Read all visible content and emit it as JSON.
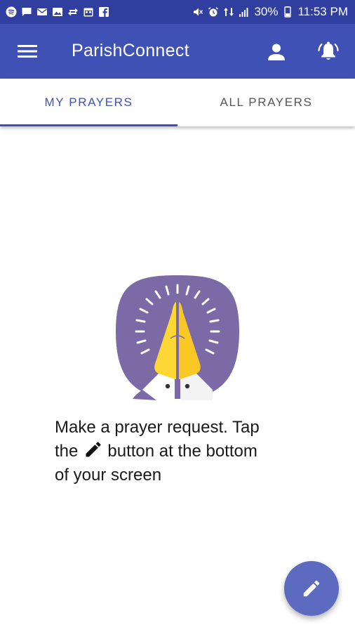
{
  "status_bar": {
    "battery": "30%",
    "time": "11:53 PM",
    "left_icons": [
      "spotify-icon",
      "message-icon",
      "mail-icon",
      "image-icon",
      "transfer-icon",
      "calendar-icon",
      "facebook-icon"
    ],
    "right_icons": [
      "mute-icon",
      "alarm-icon",
      "data-icon",
      "signal-icon",
      "battery-icon"
    ]
  },
  "app_bar": {
    "title": "ParishConnect",
    "menu_icon": "menu-icon",
    "profile_icon": "person-icon",
    "notification_icon": "bell-icon"
  },
  "tabs": [
    {
      "label": "MY PRAYERS",
      "active": true
    },
    {
      "label": "ALL PRAYERS",
      "active": false
    }
  ],
  "empty_state": {
    "illustration": "praying-hands-icon",
    "line1": "Make a prayer request. Tap",
    "line2_before": "the",
    "line2_after": "button at the bottom",
    "line3": "of your screen"
  },
  "fab": {
    "icon": "pencil-icon"
  },
  "colors": {
    "status_bar": "#303f9f",
    "app_bar": "#3f51b5",
    "accent": "#3f51b5",
    "fab": "#5c6bc0",
    "illustration_bg": "#7b6aa6",
    "hands": "#fdd835"
  }
}
